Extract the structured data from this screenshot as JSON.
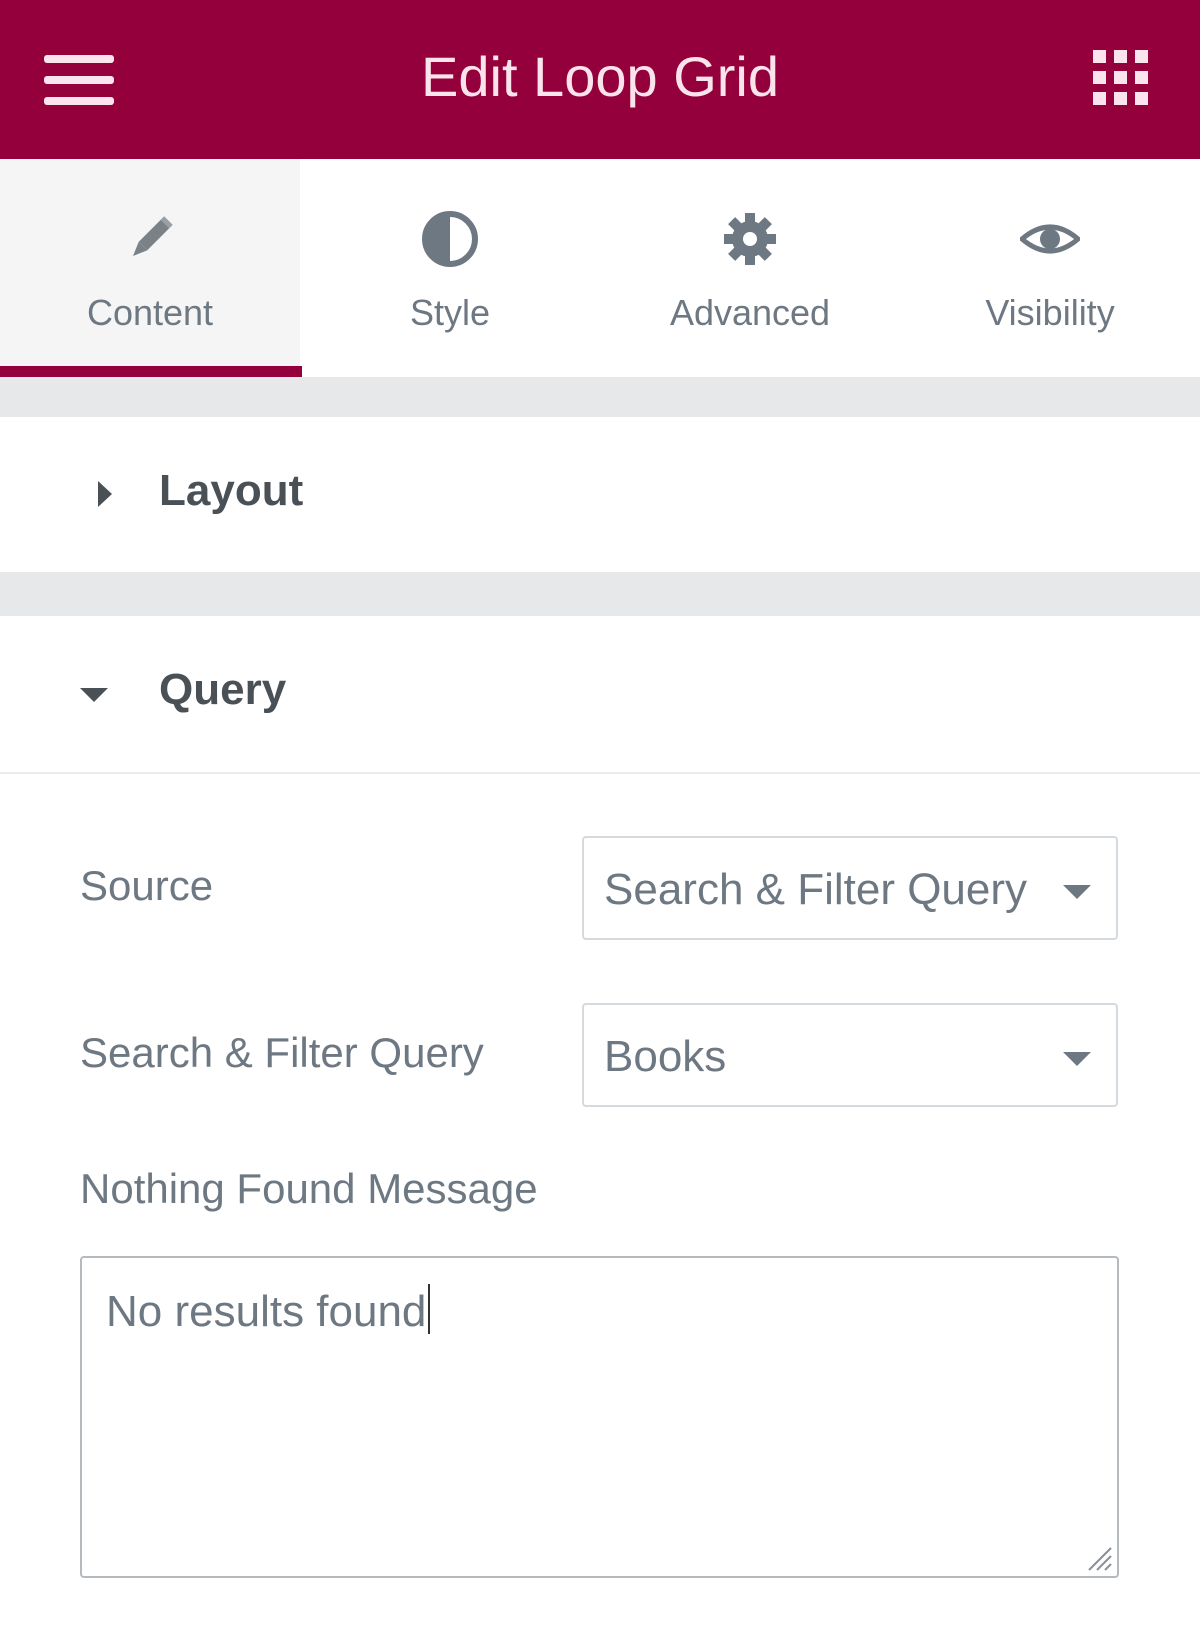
{
  "header": {
    "title": "Edit Loop Grid",
    "menu_icon": "hamburger-menu-icon",
    "apps_icon": "apps-grid-icon",
    "background_color": "#93003c"
  },
  "tabs": [
    {
      "label": "Content",
      "icon": "pencil-icon",
      "active": true
    },
    {
      "label": "Style",
      "icon": "half-circle-icon",
      "active": false
    },
    {
      "label": "Advanced",
      "icon": "gear-icon",
      "active": false
    },
    {
      "label": "Visibility",
      "icon": "eye-icon",
      "active": false
    }
  ],
  "sections": {
    "layout": {
      "title": "Layout",
      "expanded": false
    },
    "query": {
      "title": "Query",
      "expanded": true
    }
  },
  "query": {
    "source_label": "Source",
    "source_value": "Search & Filter Query",
    "sf_query_label": "Search & Filter Query",
    "sf_query_value": "Books",
    "nothing_found_label": "Nothing Found Message",
    "nothing_found_value": "No results found"
  },
  "colors": {
    "accent": "#93003c",
    "text_muted": "#6d7882",
    "text_heading": "#495157"
  }
}
